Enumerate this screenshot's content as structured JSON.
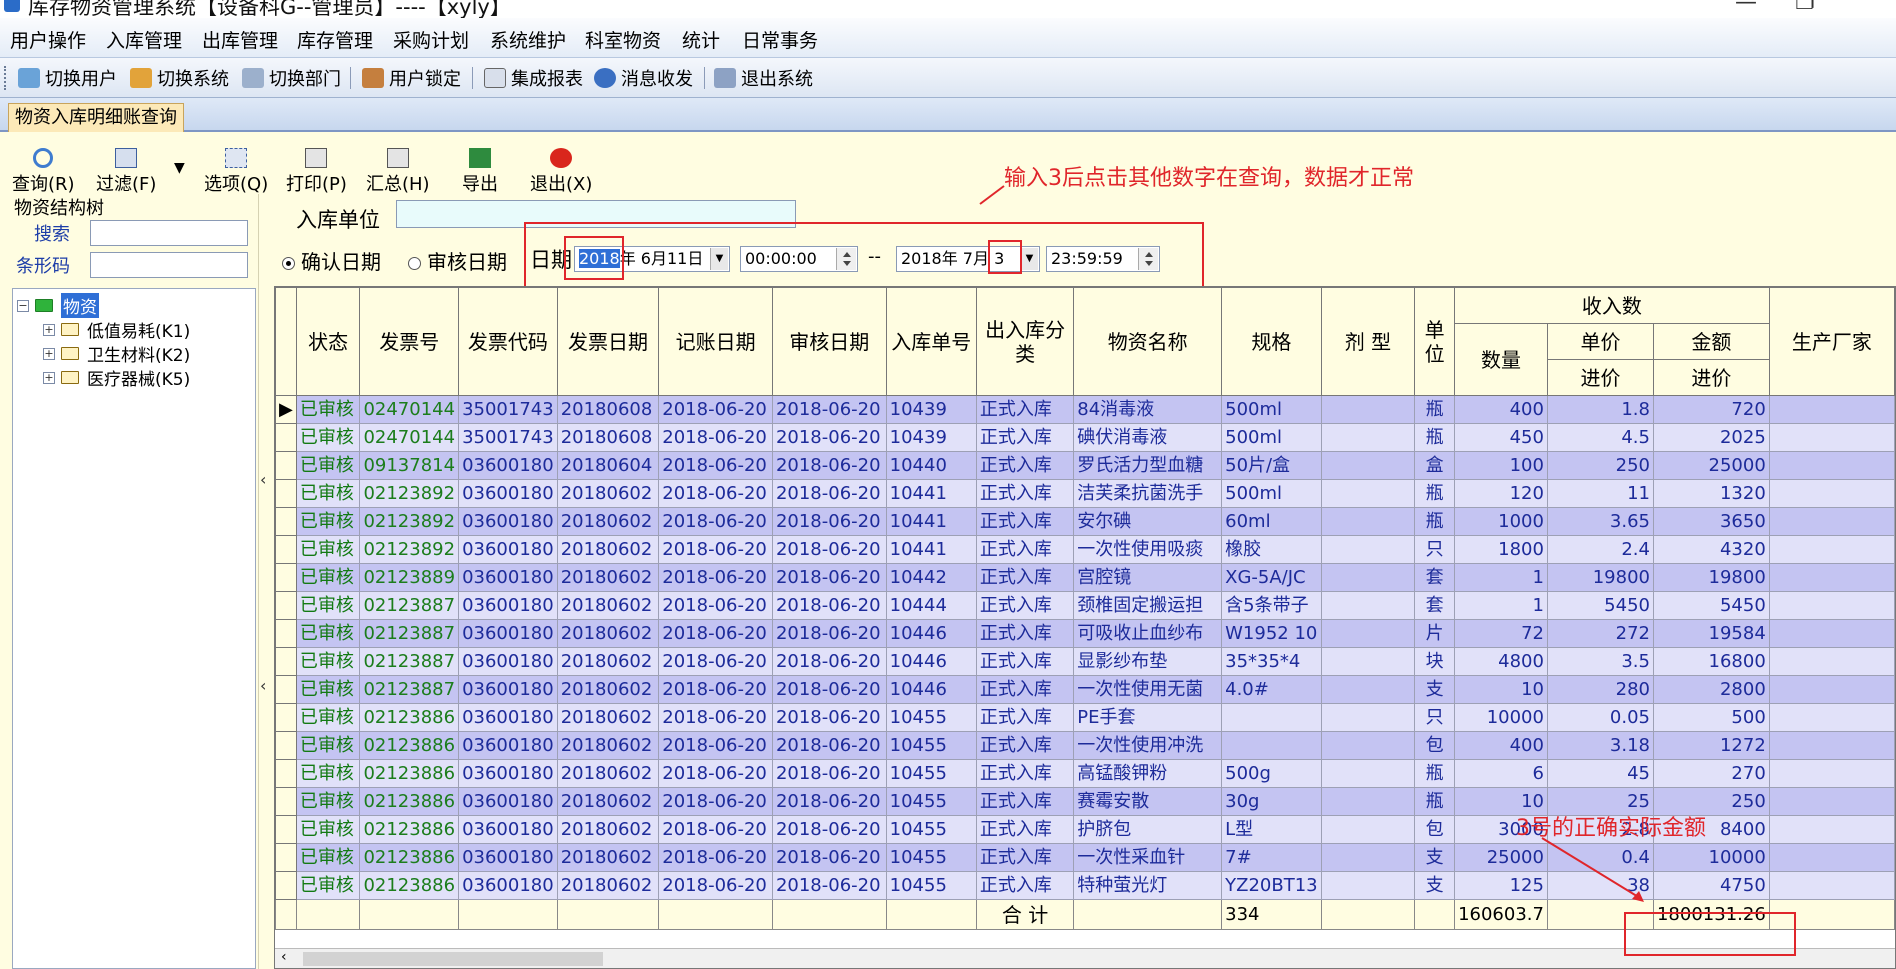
{
  "window": {
    "title": "库存物资管理系统【设备科G--管理员】----【xyly】"
  },
  "menu": [
    "用户操作",
    "入库管理",
    "出库管理",
    "库存管理",
    "采购计划",
    "系统维护",
    "科室物资",
    "统计",
    "日常事务"
  ],
  "toolbar": {
    "switch_user": "切换用户",
    "switch_system": "切换系统",
    "switch_dept": "切换部门",
    "user_lock": "用户锁定",
    "integrated_report": "集成报表",
    "messages": "消息收发",
    "exit": "退出系统"
  },
  "tab": {
    "label": "物资入库明细账查询"
  },
  "actions": {
    "query": "查询(R)",
    "filter": "过滤(F)",
    "options": "选项(Q)",
    "print": "打印(P)",
    "summary": "汇总(H)",
    "export": "导出",
    "exit": "退出(X)"
  },
  "leftpanel": {
    "title": "物资结构树",
    "search_label": "搜索",
    "barcode_label": "条形码",
    "tree": {
      "root": "物资",
      "children": [
        "低值易耗(K1)",
        "卫生材料(K2)",
        "医疗器械(K5)"
      ]
    }
  },
  "filter": {
    "unit_label": "入库单位",
    "radio_confirm": "确认日期",
    "radio_audit": "审核日期",
    "date_label": "日期",
    "start_year": "2018",
    "start_rest": "年 6月11日",
    "start_time": "00:00:00",
    "range_sep": "--",
    "end_date": "2018年 7月",
    "end_day": "3",
    "end_time": "23:59:59"
  },
  "annotations": {
    "note_top": "输入3后点击其他数字在查询，数据才正常",
    "note_bottom": "3号的正确实际金额"
  },
  "grid": {
    "headers": {
      "status": "状态",
      "invoice_no": "发票号",
      "invoice_code": "发票代码",
      "invoice_date": "发票日期",
      "post_date": "记账日期",
      "audit_date": "审核日期",
      "entry_no": "入库单号",
      "io_type": "出入库分类",
      "name": "物资名称",
      "spec": "规格",
      "form": "剂 型",
      "unit": "单位",
      "income_group": "收入数",
      "qty": "数量",
      "unit_price": "单价",
      "amount": "金额",
      "purchase_price": "进价",
      "purchase_price2": "进价",
      "maker": "生产厂家"
    },
    "rows": [
      [
        "已审核",
        "02470144",
        "35001743",
        "20180608",
        "2018-06-20",
        "2018-06-20",
        "10439",
        "正式入库",
        "84消毒液",
        "500ml",
        "",
        "瓶",
        "400",
        "1.8",
        "720"
      ],
      [
        "已审核",
        "02470144",
        "35001743",
        "20180608",
        "2018-06-20",
        "2018-06-20",
        "10439",
        "正式入库",
        "碘伏消毒液",
        "500ml",
        "",
        "瓶",
        "450",
        "4.5",
        "2025"
      ],
      [
        "已审核",
        "09137814",
        "03600180",
        "20180604",
        "2018-06-20",
        "2018-06-20",
        "10440",
        "正式入库",
        "罗氏活力型血糖",
        "50片/盒",
        "",
        "盒",
        "100",
        "250",
        "25000"
      ],
      [
        "已审核",
        "02123892",
        "03600180",
        "20180602",
        "2018-06-20",
        "2018-06-20",
        "10441",
        "正式入库",
        "洁芙柔抗菌洗手",
        "500ml",
        "",
        "瓶",
        "120",
        "11",
        "1320"
      ],
      [
        "已审核",
        "02123892",
        "03600180",
        "20180602",
        "2018-06-20",
        "2018-06-20",
        "10441",
        "正式入库",
        "安尔碘",
        "60ml",
        "",
        "瓶",
        "1000",
        "3.65",
        "3650"
      ],
      [
        "已审核",
        "02123892",
        "03600180",
        "20180602",
        "2018-06-20",
        "2018-06-20",
        "10441",
        "正式入库",
        "一次性使用吸痰",
        "橡胶",
        "",
        "只",
        "1800",
        "2.4",
        "4320"
      ],
      [
        "已审核",
        "02123889",
        "03600180",
        "20180602",
        "2018-06-20",
        "2018-06-20",
        "10442",
        "正式入库",
        "宫腔镜",
        "XG-5A/JC",
        "",
        "套",
        "1",
        "19800",
        "19800"
      ],
      [
        "已审核",
        "02123887",
        "03600180",
        "20180602",
        "2018-06-20",
        "2018-06-20",
        "10444",
        "正式入库",
        "颈椎固定搬运担",
        "含5条带子",
        "",
        "套",
        "1",
        "5450",
        "5450"
      ],
      [
        "已审核",
        "02123887",
        "03600180",
        "20180602",
        "2018-06-20",
        "2018-06-20",
        "10446",
        "正式入库",
        "可吸收止血纱布",
        "W1952 10",
        "",
        "片",
        "72",
        "272",
        "19584"
      ],
      [
        "已审核",
        "02123887",
        "03600180",
        "20180602",
        "2018-06-20",
        "2018-06-20",
        "10446",
        "正式入库",
        "显影纱布垫",
        "35*35*4",
        "",
        "块",
        "4800",
        "3.5",
        "16800"
      ],
      [
        "已审核",
        "02123887",
        "03600180",
        "20180602",
        "2018-06-20",
        "2018-06-20",
        "10446",
        "正式入库",
        "一次性使用无菌",
        "4.0#",
        "",
        "支",
        "10",
        "280",
        "2800"
      ],
      [
        "已审核",
        "02123886",
        "03600180",
        "20180602",
        "2018-06-20",
        "2018-06-20",
        "10455",
        "正式入库",
        "PE手套",
        "",
        "",
        "只",
        "10000",
        "0.05",
        "500"
      ],
      [
        "已审核",
        "02123886",
        "03600180",
        "20180602",
        "2018-06-20",
        "2018-06-20",
        "10455",
        "正式入库",
        "一次性使用冲洗",
        "",
        "",
        "包",
        "400",
        "3.18",
        "1272"
      ],
      [
        "已审核",
        "02123886",
        "03600180",
        "20180602",
        "2018-06-20",
        "2018-06-20",
        "10455",
        "正式入库",
        "高锰酸钾粉",
        "500g",
        "",
        "瓶",
        "6",
        "45",
        "270"
      ],
      [
        "已审核",
        "02123886",
        "03600180",
        "20180602",
        "2018-06-20",
        "2018-06-20",
        "10455",
        "正式入库",
        "赛霉安散",
        "30g",
        "",
        "瓶",
        "10",
        "25",
        "250"
      ],
      [
        "已审核",
        "02123886",
        "03600180",
        "20180602",
        "2018-06-20",
        "2018-06-20",
        "10455",
        "正式入库",
        "护脐包",
        "L型",
        "",
        "包",
        "3000",
        "2.8",
        "8400"
      ],
      [
        "已审核",
        "02123886",
        "03600180",
        "20180602",
        "2018-06-20",
        "2018-06-20",
        "10455",
        "正式入库",
        "一次性采血针",
        "7#",
        "",
        "支",
        "25000",
        "0.4",
        "10000"
      ],
      [
        "已审核",
        "02123886",
        "03600180",
        "20180602",
        "2018-06-20",
        "2018-06-20",
        "10455",
        "正式入库",
        "特种萤光灯",
        "YZ20BT13",
        "",
        "支",
        "125",
        "38",
        "4750"
      ]
    ],
    "total": {
      "label": "合 计",
      "spec_total": "334",
      "qty_total": "160603.7",
      "amount_total": "1800131.26"
    }
  },
  "colors": {
    "accent_red": "#e0262b",
    "row_odd": "#c4c4f2",
    "row_even": "#e1e1f9",
    "status_green": "#137a13"
  }
}
